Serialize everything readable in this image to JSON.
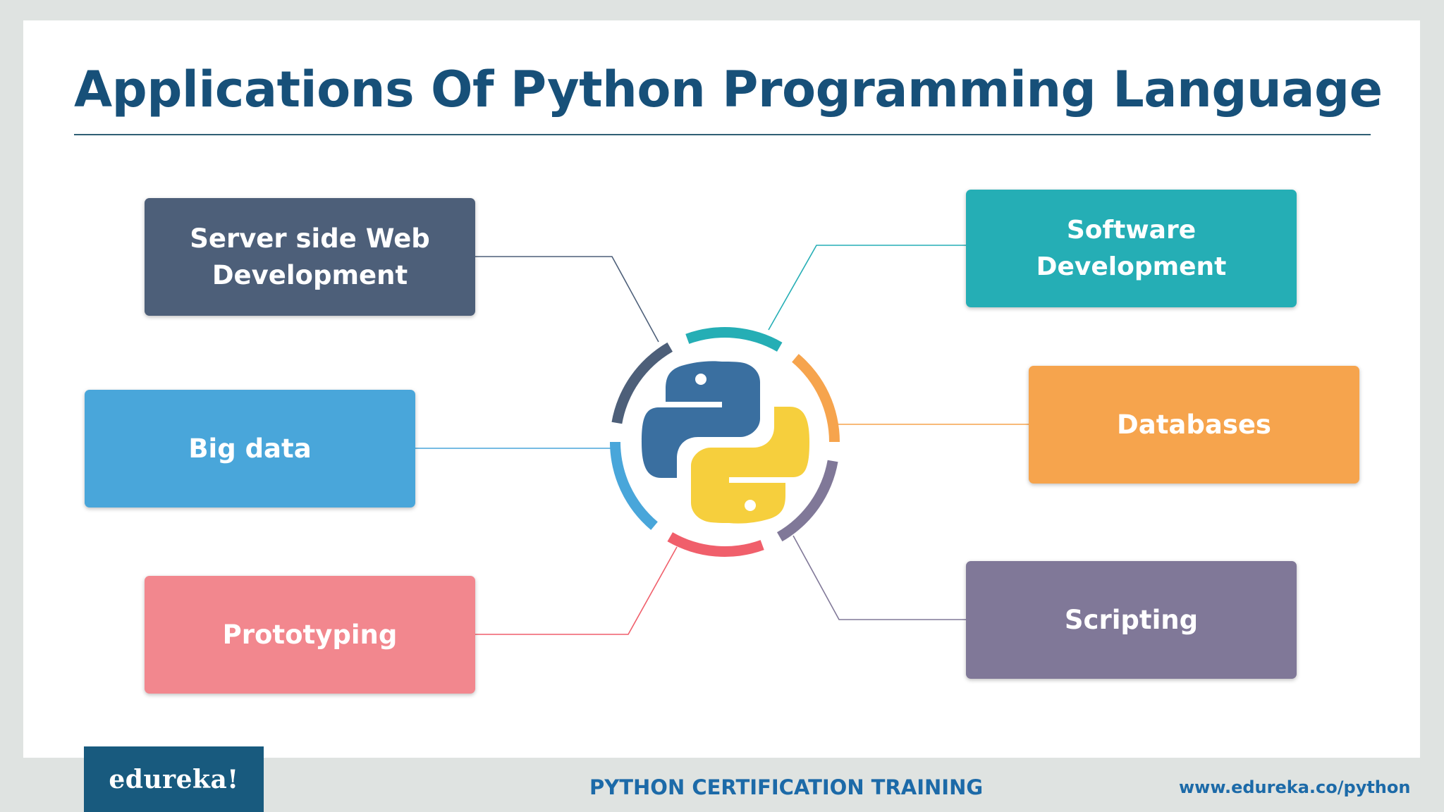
{
  "title": "Applications Of Python Programming Language",
  "applications": [
    {
      "label": "Server side Web\nDevelopment",
      "color": "#4d5f79"
    },
    {
      "label": "Big data",
      "color": "#49a6da"
    },
    {
      "label": "Prototyping",
      "color": "#f2878e"
    },
    {
      "label": "Software Development",
      "color": "#25aeb5"
    },
    {
      "label": "Databases",
      "color": "#f6a44d"
    },
    {
      "label": "Scripting",
      "color": "#807898"
    }
  ],
  "center_icon": "python-logo-icon",
  "ring_colors": [
    "#25aeb5",
    "#f6a44d",
    "#807898",
    "#f05f6b",
    "#49a6da",
    "#4d5f79"
  ],
  "python_colors": {
    "blue": "#3a6fa0",
    "yellow": "#f6cf3d"
  },
  "footer": {
    "logo": "edureka!",
    "course": "PYTHON CERTIFICATION TRAINING",
    "url": "www.edureka.co/python"
  }
}
